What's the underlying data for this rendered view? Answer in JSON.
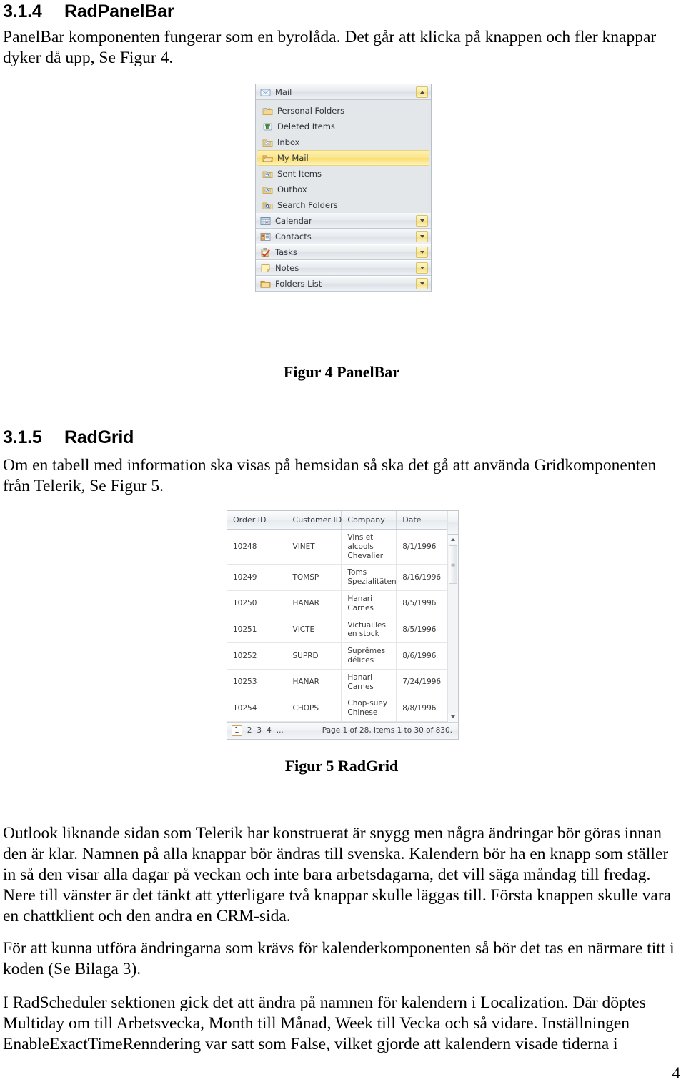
{
  "document": {
    "page_number": "4"
  },
  "sections": [
    {
      "number": "3.1.4",
      "title": "RadPanelBar",
      "paragraph": "PanelBar komponenten fungerar som en byrolåda. Det går att klicka på knappen och fler knappar dyker då upp, Se Figur 4."
    },
    {
      "number": "3.1.5",
      "title": "RadGrid",
      "paragraph": "Om en tabell med information ska visas på hemsidan så ska det gå att använda Gridkomponenten från Telerik, Se Figur 5."
    }
  ],
  "figures": [
    {
      "caption": "Figur 4 PanelBar"
    },
    {
      "caption": "Figur 5 RadGrid"
    }
  ],
  "panelbar": {
    "groups": [
      {
        "label": "Mail",
        "icon": "mail-icon",
        "state": "expanded",
        "toggle": "triangle-up"
      },
      {
        "label": "Calendar",
        "icon": "calendar-icon",
        "state": "collapsed",
        "toggle": "triangle-down"
      },
      {
        "label": "Contacts",
        "icon": "contacts-icon",
        "state": "collapsed",
        "toggle": "triangle-down"
      },
      {
        "label": "Tasks",
        "icon": "tasks-icon",
        "state": "collapsed",
        "toggle": "triangle-down"
      },
      {
        "label": "Notes",
        "icon": "notes-icon",
        "state": "collapsed",
        "toggle": "triangle-down"
      },
      {
        "label": "Folders List",
        "icon": "folder-icon",
        "state": "collapsed",
        "toggle": "triangle-down"
      }
    ],
    "mail_items": [
      {
        "label": "Personal Folders",
        "icon": "personal-folders-icon",
        "selected": false
      },
      {
        "label": "Deleted Items",
        "icon": "deleted-items-icon",
        "selected": false
      },
      {
        "label": "Inbox",
        "icon": "inbox-folder-icon",
        "selected": false
      },
      {
        "label": "My Mail",
        "icon": "folder-open-icon",
        "selected": true
      },
      {
        "label": "Sent Items",
        "icon": "sent-items-icon",
        "selected": false
      },
      {
        "label": "Outbox",
        "icon": "outbox-icon",
        "selected": false
      },
      {
        "label": "Search Folders",
        "icon": "search-folders-icon",
        "selected": false
      }
    ],
    "colors": {
      "selected_highlight": "#fbe58b",
      "toggle_button": "#f8eaa0",
      "panel_background": "#e3e7ea"
    }
  },
  "radgrid": {
    "columns": [
      "Order ID",
      "Customer ID",
      "Company",
      "Date"
    ],
    "rows": [
      [
        "10248",
        "VINET",
        "Vins et alcools Chevalier",
        "8/1/1996"
      ],
      [
        "10249",
        "TOMSP",
        "Toms Spezialitäten",
        "8/16/1996"
      ],
      [
        "10250",
        "HANAR",
        "Hanari Carnes",
        "8/5/1996"
      ],
      [
        "10251",
        "VICTE",
        "Victuailles en stock",
        "8/5/1996"
      ],
      [
        "10252",
        "SUPRD",
        "Suprêmes délices",
        "8/6/1996"
      ],
      [
        "10253",
        "HANAR",
        "Hanari Carnes",
        "7/24/1996"
      ],
      [
        "10254",
        "CHOPS",
        "Chop-suey Chinese",
        "8/8/1996"
      ]
    ],
    "pager": {
      "pages": [
        "1",
        "2",
        "3",
        "4",
        "..."
      ],
      "current_page": "1",
      "info": "Page 1 of 28, items 1 to 30 of 830."
    },
    "scrollbar": {
      "up": "scroll-up-arrow",
      "down": "scroll-down-arrow",
      "grip": "≡"
    }
  },
  "body": {
    "paragraph_1": "Outlook liknande sidan som Telerik har konstruerat är snygg men några ändringar bör göras innan den är klar. Namnen på alla knappar bör ändras till svenska. Kalendern bör ha en knapp som ställer in så den visar alla dagar på veckan och inte bara arbetsdagarna, det vill säga måndag till fredag. Nere till vänster är det tänkt att ytterligare två knappar skulle läggas till. Första knappen skulle vara en chattklient och den andra en CRM-sida.",
    "paragraph_2": "För att kunna utföra ändringarna som krävs för kalenderkomponenten så bör det tas en närmare titt i koden (Se Bilaga 3).",
    "paragraph_3": "I RadScheduler sektionen gick det att ändra på namnen för kalendern i Localization. Där döptes Multiday om till Arbetsvecka, Month till Månad, Week till Vecka och så vidare. Inställningen EnableExactTimeRenndering var satt som False, vilket gjorde att kalendern visade tiderna i"
  }
}
